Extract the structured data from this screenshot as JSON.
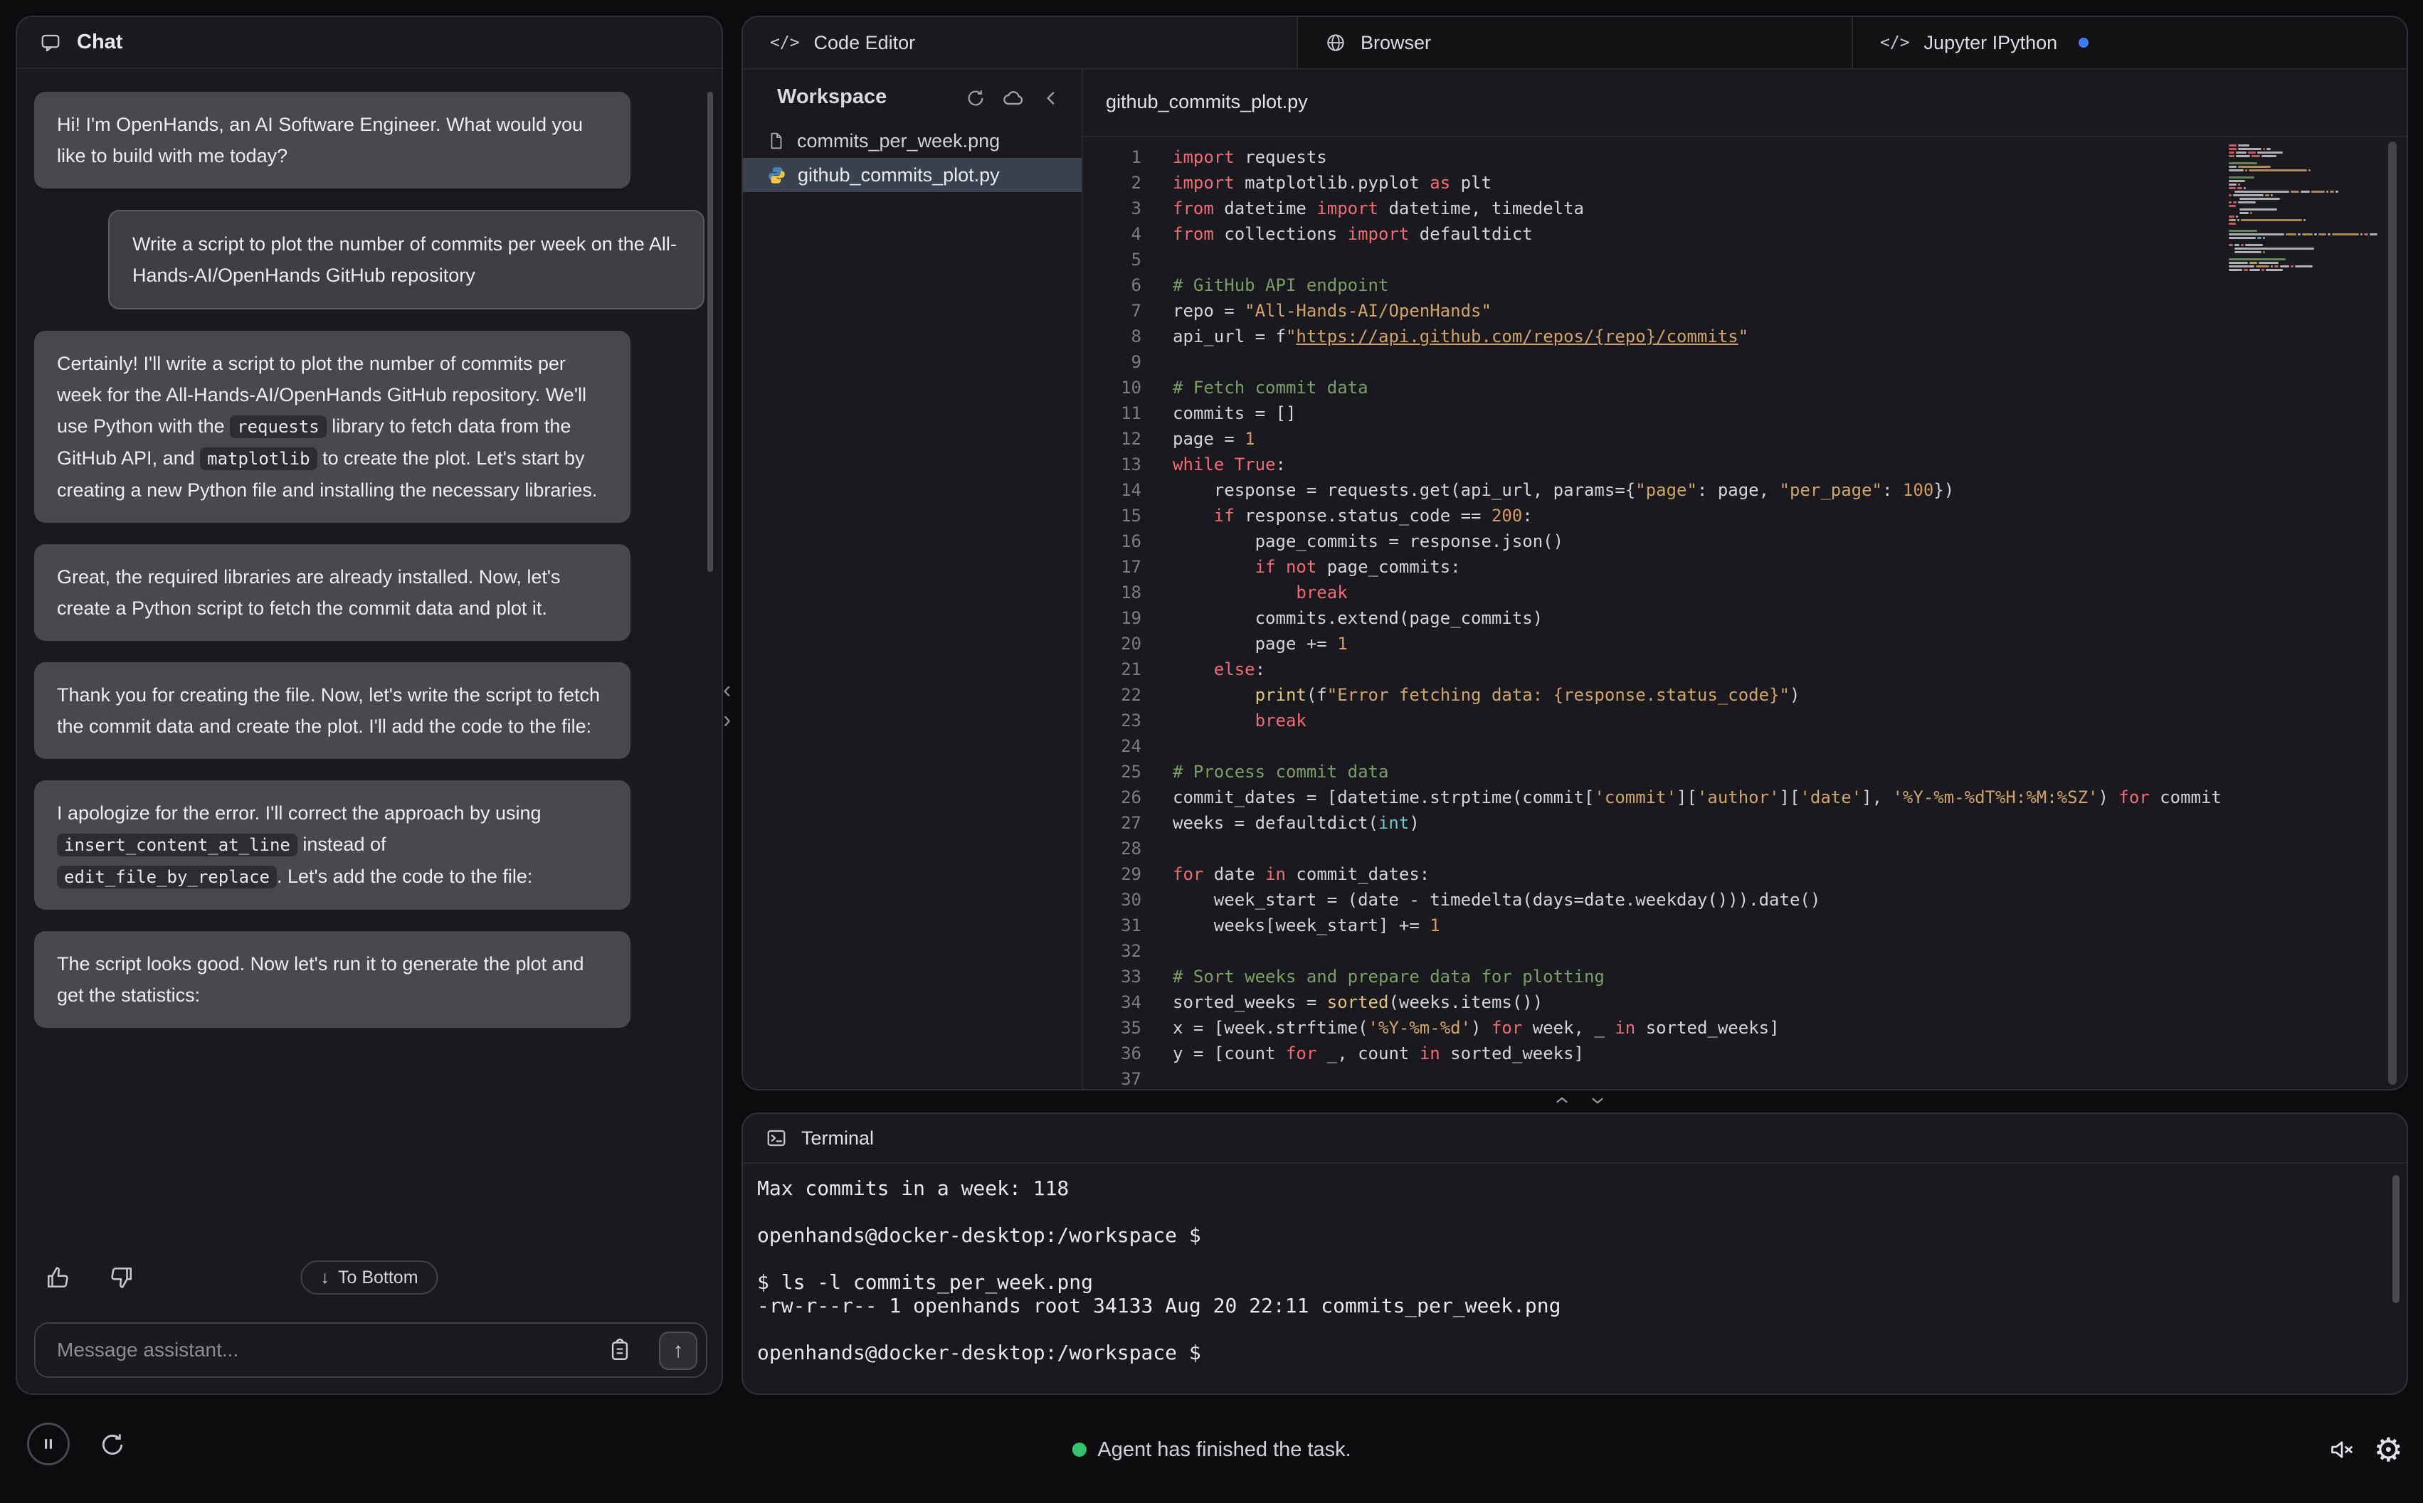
{
  "chat": {
    "title": "Chat",
    "header_icon": "chat-bubble-icon",
    "messages": [
      {
        "role": "assistant",
        "parts": [
          {
            "t": "Hi! I'm OpenHands, an AI Software Engineer. What would you like to build with me today?"
          }
        ]
      },
      {
        "role": "user",
        "parts": [
          {
            "t": "Write a script to plot the number of commits per week on the All-Hands-AI/OpenHands GitHub repository"
          }
        ]
      },
      {
        "role": "assistant",
        "parts": [
          {
            "t": "Certainly! I'll write a script to plot the number of commits per week for the All-Hands-AI/OpenHands GitHub repository. We'll use Python with the "
          },
          {
            "t": "requests",
            "code": true
          },
          {
            "t": " library to fetch data from the GitHub API, and "
          },
          {
            "t": "matplotlib",
            "code": true
          },
          {
            "t": " to create the plot. Let's start by creating a new Python file and installing the necessary libraries."
          }
        ]
      },
      {
        "role": "assistant",
        "parts": [
          {
            "t": "Great, the required libraries are already installed. Now, let's create a Python script to fetch the commit data and plot it."
          }
        ]
      },
      {
        "role": "assistant",
        "parts": [
          {
            "t": "Thank you for creating the file. Now, let's write the script to fetch the commit data and create the plot. I'll add the code to the file:"
          }
        ]
      },
      {
        "role": "assistant",
        "parts": [
          {
            "t": "I apologize for the error. I'll correct the approach by using "
          },
          {
            "t": "insert_content_at_line",
            "code": true
          },
          {
            "t": " instead of "
          },
          {
            "t": "edit_file_by_replace",
            "code": true
          },
          {
            "t": ". Let's add the code to the file:"
          }
        ]
      },
      {
        "role": "assistant",
        "parts": [
          {
            "t": "The script looks good. Now let's run it to generate the plot and get the statistics:"
          }
        ]
      }
    ],
    "to_bottom_label": "To Bottom",
    "input_placeholder": "Message assistant..."
  },
  "tabs": [
    {
      "label": "Code Editor",
      "icon": "code-icon",
      "active": true
    },
    {
      "label": "Browser",
      "icon": "globe-icon",
      "active": false
    },
    {
      "label": "Jupyter IPython",
      "icon": "code-icon",
      "active": false,
      "has_dot": true
    }
  ],
  "workspace": {
    "title": "Workspace",
    "header_icons": [
      "refresh-icon",
      "cloud-sync-icon",
      "chevron-left-icon"
    ],
    "files": [
      {
        "name": "commits_per_week.png",
        "icon": "file-icon",
        "selected": false
      },
      {
        "name": "github_commits_plot.py",
        "icon": "python-icon",
        "selected": true
      }
    ]
  },
  "editor": {
    "file_tab": "github_commits_plot.py",
    "lines": [
      [
        [
          "k",
          "import"
        ],
        [
          "d",
          " requests"
        ]
      ],
      [
        [
          "k",
          "import"
        ],
        [
          "d",
          " matplotlib.pyplot "
        ],
        [
          "k",
          "as"
        ],
        [
          "d",
          " plt"
        ]
      ],
      [
        [
          "k",
          "from"
        ],
        [
          "d",
          " datetime "
        ],
        [
          "k",
          "import"
        ],
        [
          "d",
          " datetime, timedelta"
        ]
      ],
      [
        [
          "k",
          "from"
        ],
        [
          "d",
          " collections "
        ],
        [
          "k",
          "import"
        ],
        [
          "d",
          " defaultdict"
        ]
      ],
      [],
      [
        [
          "c",
          "# GitHub API endpoint"
        ]
      ],
      [
        [
          "d",
          "repo = "
        ],
        [
          "s",
          "\"All-Hands-AI/OpenHands\""
        ]
      ],
      [
        [
          "d",
          "api_url = f"
        ],
        [
          "s",
          "\""
        ],
        [
          "u",
          "https://api.github.com/repos/{repo}/commits"
        ],
        [
          "s",
          "\""
        ]
      ],
      [],
      [
        [
          "c",
          "# Fetch commit data"
        ]
      ],
      [
        [
          "d",
          "commits = []"
        ]
      ],
      [
        [
          "d",
          "page = "
        ],
        [
          "n",
          "1"
        ]
      ],
      [
        [
          "k",
          "while"
        ],
        [
          "d",
          " "
        ],
        [
          "k",
          "True"
        ],
        [
          "d",
          ":"
        ]
      ],
      [
        [
          "d",
          "    response = requests.get(api_url, params={"
        ],
        [
          "s",
          "\"page\""
        ],
        [
          "d",
          ": page, "
        ],
        [
          "s",
          "\"per_page\""
        ],
        [
          "d",
          ": "
        ],
        [
          "n",
          "100"
        ],
        [
          "d",
          "})"
        ]
      ],
      [
        [
          "d",
          "    "
        ],
        [
          "k",
          "if"
        ],
        [
          "d",
          " response.status_code == "
        ],
        [
          "n",
          "200"
        ],
        [
          "d",
          ":"
        ]
      ],
      [
        [
          "d",
          "        page_commits = response.json()"
        ]
      ],
      [
        [
          "d",
          "        "
        ],
        [
          "k",
          "if"
        ],
        [
          "d",
          " "
        ],
        [
          "k",
          "not"
        ],
        [
          "d",
          " page_commits:"
        ]
      ],
      [
        [
          "d",
          "            "
        ],
        [
          "k",
          "break"
        ]
      ],
      [
        [
          "d",
          "        commits.extend(page_commits)"
        ]
      ],
      [
        [
          "d",
          "        page += "
        ],
        [
          "n",
          "1"
        ]
      ],
      [
        [
          "d",
          "    "
        ],
        [
          "k",
          "else"
        ],
        [
          "d",
          ":"
        ]
      ],
      [
        [
          "d",
          "        "
        ],
        [
          "f",
          "print"
        ],
        [
          "d",
          "(f"
        ],
        [
          "s",
          "\"Error fetching data: {response.status_code}\""
        ],
        [
          "d",
          ")"
        ]
      ],
      [
        [
          "d",
          "        "
        ],
        [
          "k",
          "break"
        ]
      ],
      [],
      [
        [
          "c",
          "# Process commit data"
        ]
      ],
      [
        [
          "d",
          "commit_dates = [datetime.strptime(commit["
        ],
        [
          "s",
          "'commit'"
        ],
        [
          "d",
          "]["
        ],
        [
          "s",
          "'author'"
        ],
        [
          "d",
          "]["
        ],
        [
          "s",
          "'date'"
        ],
        [
          "d",
          "], "
        ],
        [
          "s",
          "'%Y-%m-%dT%H:%M:%SZ'"
        ],
        [
          "d",
          ") "
        ],
        [
          "k",
          "for"
        ],
        [
          "d",
          " commit"
        ]
      ],
      [
        [
          "d",
          "weeks = defaultdict("
        ],
        [
          "t",
          "int"
        ],
        [
          "d",
          ")"
        ]
      ],
      [],
      [
        [
          "k",
          "for"
        ],
        [
          "d",
          " date "
        ],
        [
          "k",
          "in"
        ],
        [
          "d",
          " commit_dates:"
        ]
      ],
      [
        [
          "d",
          "    week_start = (date - timedelta(days=date.weekday())).date()"
        ]
      ],
      [
        [
          "d",
          "    weeks[week_start] += "
        ],
        [
          "n",
          "1"
        ]
      ],
      [],
      [
        [
          "c",
          "# Sort weeks and prepare data for plotting"
        ]
      ],
      [
        [
          "d",
          "sorted_weeks = "
        ],
        [
          "f",
          "sorted"
        ],
        [
          "d",
          "(weeks.items())"
        ]
      ],
      [
        [
          "d",
          "x = [week.strftime("
        ],
        [
          "s",
          "'%Y-%m-%d'"
        ],
        [
          "d",
          ") "
        ],
        [
          "k",
          "for"
        ],
        [
          "d",
          " week, _ "
        ],
        [
          "k",
          "in"
        ],
        [
          "d",
          " sorted_weeks]"
        ]
      ],
      [
        [
          "d",
          "y = [count "
        ],
        [
          "k",
          "for"
        ],
        [
          "d",
          " _, count "
        ],
        [
          "k",
          "in"
        ],
        [
          "d",
          " sorted_weeks]"
        ]
      ],
      []
    ]
  },
  "terminal": {
    "title": "Terminal",
    "icon": "terminal-icon",
    "lines": [
      "Max commits in a week: 118",
      "",
      "openhands@docker-desktop:/workspace $",
      "",
      "$ ls -l commits_per_week.png",
      "-rw-r--r-- 1 openhands root 34133 Aug 20 22:11 commits_per_week.png",
      "",
      "openhands@docker-desktop:/workspace $"
    ]
  },
  "statusbar": {
    "status_text": "Agent has finished the task.",
    "icons": [
      "pause-icon",
      "refresh-icon",
      "sound-muted-icon",
      "gear-icon"
    ]
  },
  "colors": {
    "accent_blue": "#3e7bfa",
    "status_green": "#35c26f",
    "selected_file_bg": "#3a4150",
    "python_blue": "#4584b6",
    "python_yellow": "#f5c542",
    "syntax": {
      "d": "#d4d4d8",
      "k": "#ef6b78",
      "s": "#cfa36a",
      "u": "#cfa36a",
      "c": "#7a9e68",
      "n": "#d19a66",
      "f": "#e2c07a",
      "t": "#6ec5cf"
    }
  }
}
